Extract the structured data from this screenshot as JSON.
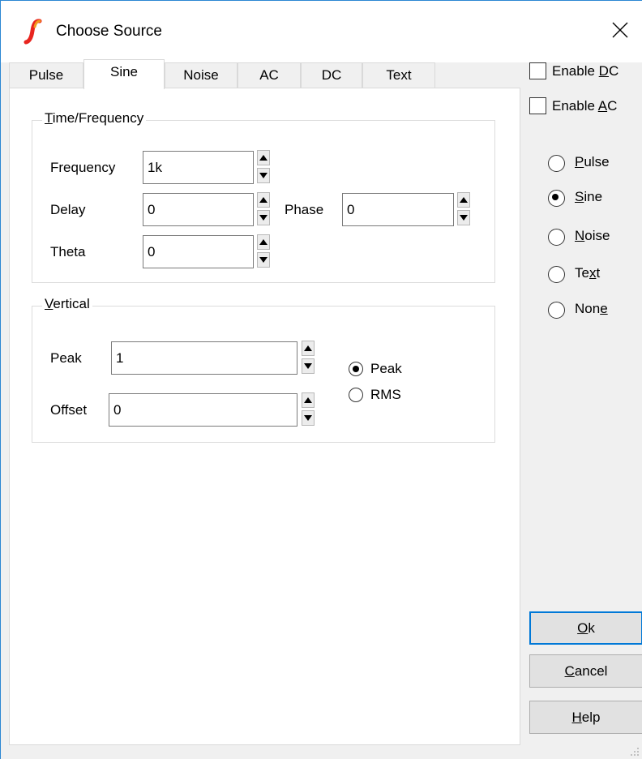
{
  "window": {
    "title": "Choose Source",
    "app_icon": "simetrix-logo-icon",
    "close_glyph": "✕"
  },
  "tabs": [
    {
      "label": "Pulse",
      "active": false
    },
    {
      "label": "Sine",
      "active": true
    },
    {
      "label": "Noise",
      "active": false
    },
    {
      "label": "AC",
      "active": false
    },
    {
      "label": "DC",
      "active": false
    },
    {
      "label": "Text",
      "active": false
    }
  ],
  "time_frequency": {
    "legend_pre": "",
    "legend_mnemonic": "T",
    "legend_post": "ime/Frequency",
    "frequency_label": "Frequency",
    "frequency_value": "1k",
    "delay_label": "Delay",
    "delay_value": "0",
    "phase_label": "Phase",
    "phase_value": "0",
    "theta_label": "Theta",
    "theta_value": "0"
  },
  "vertical": {
    "legend_pre": "",
    "legend_mnemonic": "V",
    "legend_post": "ertical",
    "peak_label": "Peak",
    "peak_value": "1",
    "offset_label": "Offset",
    "offset_value": "0",
    "mode_options": [
      {
        "label": "Peak",
        "checked": true
      },
      {
        "label": "RMS",
        "checked": false
      }
    ]
  },
  "enable": {
    "dc": {
      "pre": "Enable ",
      "mnemonic": "D",
      "post": "C",
      "checked": false
    },
    "ac": {
      "pre": "Enable ",
      "mnemonic": "A",
      "post": "C",
      "checked": false
    }
  },
  "source_type": [
    {
      "pre": "",
      "mnemonic": "P",
      "post": "ulse",
      "checked": false
    },
    {
      "pre": "",
      "mnemonic": "S",
      "post": "ine",
      "checked": true
    },
    {
      "pre": "",
      "mnemonic": "N",
      "post": "oise",
      "checked": false
    },
    {
      "pre": "Te",
      "mnemonic": "x",
      "post": "t",
      "checked": false
    },
    {
      "pre": "Non",
      "mnemonic": "e",
      "post": "",
      "checked": false
    }
  ],
  "buttons": {
    "ok": {
      "pre": "",
      "mnemonic": "O",
      "post": "k"
    },
    "cancel": {
      "pre": "",
      "mnemonic": "C",
      "post": "ancel"
    },
    "help": {
      "pre": "",
      "mnemonic": "H",
      "post": "elp"
    }
  },
  "colors": {
    "accent": "#0078d7",
    "logo": "#e8251f"
  }
}
